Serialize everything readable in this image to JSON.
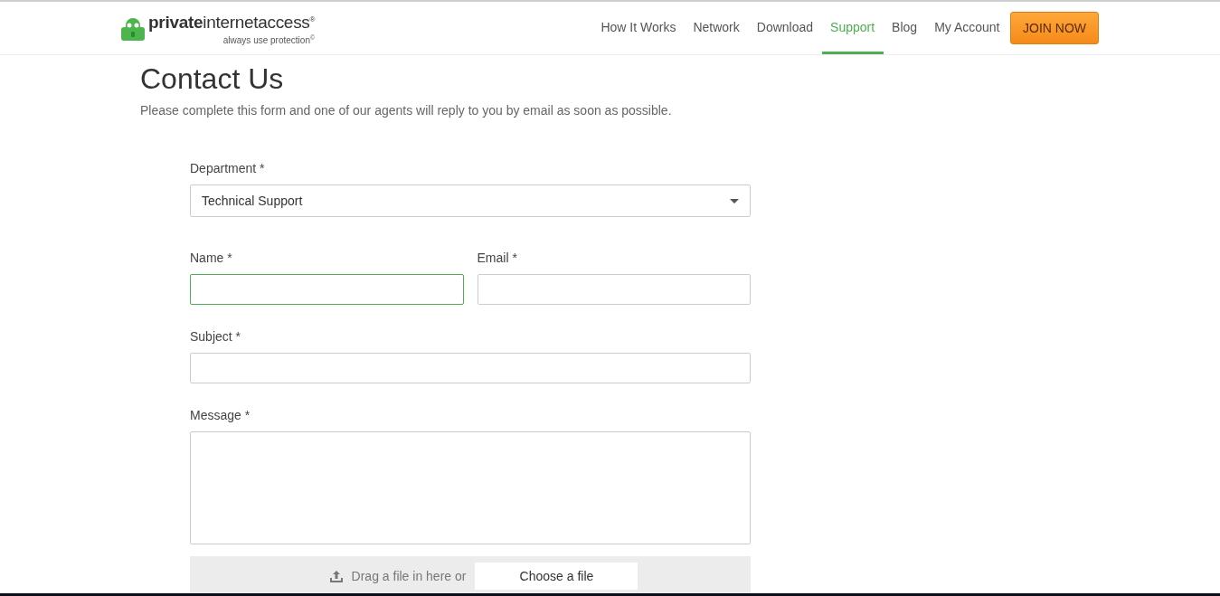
{
  "logo": {
    "brand_bold": "private",
    "brand_rest": "internetaccess",
    "registered": "®",
    "tagline": "always use protection",
    "copyright": "©"
  },
  "nav": [
    {
      "label": "How It Works",
      "selected": false
    },
    {
      "label": "Network",
      "selected": false
    },
    {
      "label": "Download",
      "selected": false
    },
    {
      "label": "Support",
      "selected": true
    },
    {
      "label": "Blog",
      "selected": false
    },
    {
      "label": "My Account",
      "selected": false
    }
  ],
  "cta": "JOIN NOW",
  "page": {
    "title": "Contact Us",
    "intro": "Please complete this form and one of our agents will reply to you by email as soon as possible."
  },
  "form": {
    "department": {
      "label": "Department *",
      "value": "Technical Support"
    },
    "name": {
      "label": "Name *",
      "focused": true
    },
    "email": {
      "label": "Email *",
      "focused": false
    },
    "subject": {
      "label": "Subject *",
      "focused": false
    },
    "message": {
      "label": "Message *"
    },
    "upload": {
      "hint": "Drag a file in here or",
      "button": "Choose a file"
    }
  }
}
